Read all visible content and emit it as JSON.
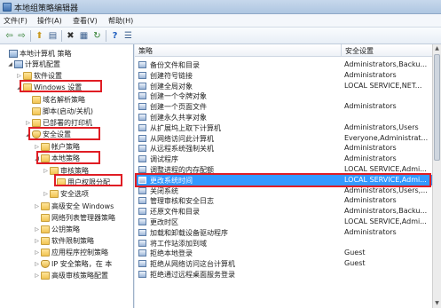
{
  "window": {
    "title": "本地组策略编辑器",
    "app_icon": "policy-editor-icon"
  },
  "menu": [
    "文件(F)",
    "操作(A)",
    "查看(V)",
    "帮助(H)"
  ],
  "toolbar": {
    "buttons": [
      {
        "name": "back-arrow-icon",
        "glyph": "⇦"
      },
      {
        "name": "forward-arrow-icon",
        "glyph": "⇨"
      },
      {
        "name": "up-folder-icon",
        "glyph": "⬆"
      },
      {
        "name": "show-hide-tree-icon",
        "glyph": "▤"
      },
      {
        "name": "delete-icon",
        "glyph": "✖"
      },
      {
        "name": "properties-icon",
        "glyph": "▦"
      },
      {
        "name": "refresh-icon",
        "glyph": "↻"
      },
      {
        "name": "help-icon",
        "glyph": "?"
      },
      {
        "name": "details-view-icon",
        "glyph": "☰"
      }
    ]
  },
  "tree": [
    {
      "label": "本地计算机 策略",
      "icon": "computer-icon"
    },
    {
      "label": "计算机配置",
      "icon": "computer-icon"
    },
    {
      "label": "软件设置",
      "icon": "folder-icon"
    },
    {
      "label": "Windows 设置",
      "icon": "folder-icon"
    },
    {
      "label": "域名解析策略",
      "icon": "folder-icon"
    },
    {
      "label": "脚本(启动/关机)",
      "icon": "folder-icon"
    },
    {
      "label": "已部署的打印机",
      "icon": "folder-icon"
    },
    {
      "label": "安全设置",
      "icon": "shield-icon"
    },
    {
      "label": "帐户策略",
      "icon": "folder-icon"
    },
    {
      "label": "本地策略",
      "icon": "folder-icon"
    },
    {
      "label": "审核策略",
      "icon": "folder-icon"
    },
    {
      "label": "用户权限分配",
      "icon": "folder-icon"
    },
    {
      "label": "安全选项",
      "icon": "folder-icon"
    },
    {
      "label": "高级安全 Windows",
      "icon": "folder-icon"
    },
    {
      "label": "网络列表管理器策略",
      "icon": "folder-icon"
    },
    {
      "label": "公钥策略",
      "icon": "folder-icon"
    },
    {
      "label": "软件限制策略",
      "icon": "folder-icon"
    },
    {
      "label": "应用程序控制策略",
      "icon": "folder-icon"
    },
    {
      "label": "IP 安全策略，在 本",
      "icon": "shield-icon"
    },
    {
      "label": "高级审核策略配置",
      "icon": "folder-icon"
    }
  ],
  "list": {
    "columns": [
      "策略",
      "安全设置"
    ],
    "selected_index": 11,
    "rows": [
      {
        "policy": "备份文件和目录",
        "setting": "Administrators,Backu..."
      },
      {
        "policy": "创建符号链接",
        "setting": "Administrators"
      },
      {
        "policy": "创建全局对象",
        "setting": "LOCAL SERVICE,NET..."
      },
      {
        "policy": "创建一个令牌对象",
        "setting": ""
      },
      {
        "policy": "创建一个页面文件",
        "setting": "Administrators"
      },
      {
        "policy": "创建永久共享对象",
        "setting": ""
      },
      {
        "policy": "从扩展坞上取下计算机",
        "setting": "Administrators,Users"
      },
      {
        "policy": "从网络访问此计算机",
        "setting": "Everyone,Administrat..."
      },
      {
        "policy": "从远程系统强制关机",
        "setting": "Administrators"
      },
      {
        "policy": "调试程序",
        "setting": "Administrators"
      },
      {
        "policy": "调整进程的内存配额",
        "setting": "LOCAL SERVICE,Admi..."
      },
      {
        "policy": "更改系统时间",
        "setting": "LOCAL SERVICE,Admi..."
      },
      {
        "policy": "关闭系统",
        "setting": "Administrators,Users,..."
      },
      {
        "policy": "管理审核和安全日志",
        "setting": "Administrators"
      },
      {
        "policy": "还原文件和目录",
        "setting": "Administrators,Backu..."
      },
      {
        "policy": "更改时区",
        "setting": "LOCAL SERVICE,Admi..."
      },
      {
        "policy": "加载和卸载设备驱动程序",
        "setting": "Administrators"
      },
      {
        "policy": "将工作站添加到域",
        "setting": ""
      },
      {
        "policy": "拒绝本地登录",
        "setting": "Guest"
      },
      {
        "policy": "拒绝从网络访问这台计算机",
        "setting": "Guest"
      },
      {
        "policy": "拒绝通过远程桌面服务登录",
        "setting": ""
      }
    ]
  }
}
